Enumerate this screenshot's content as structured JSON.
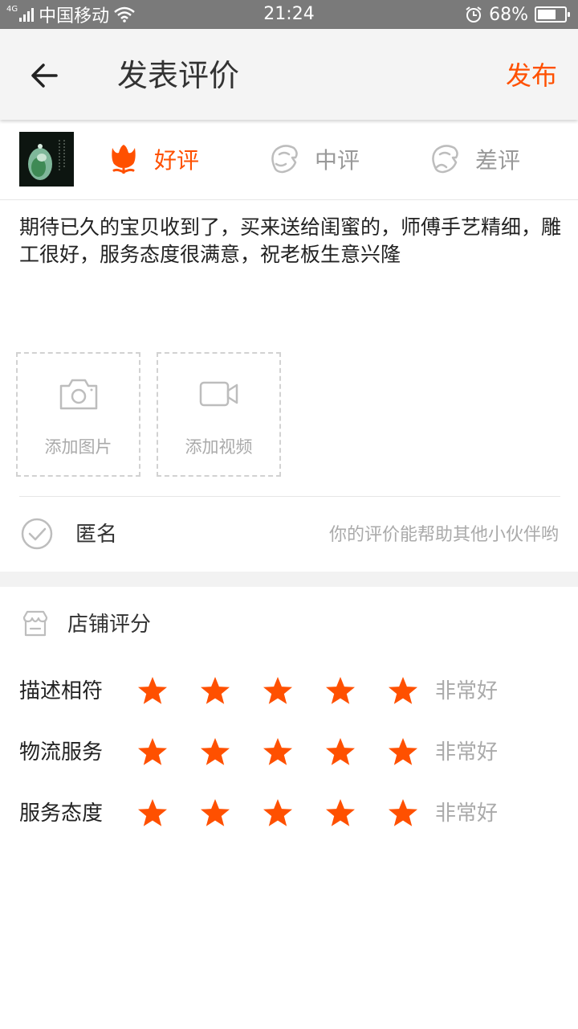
{
  "status_bar": {
    "network": "4G",
    "carrier": "中国移动",
    "time": "21:24",
    "battery": "68%",
    "battery_level": 0.68
  },
  "header": {
    "title": "发表评价",
    "publish_label": "发布"
  },
  "rating_options": {
    "good": "好评",
    "medium": "中评",
    "bad": "差评",
    "selected": "good"
  },
  "review": {
    "text": "期待已久的宝贝收到了，买来送给闺蜜的，师傅手艺精细，雕工很好，服务态度很满意，祝老板生意兴隆"
  },
  "media": {
    "add_photo": "添加图片",
    "add_video": "添加视频"
  },
  "anonymous": {
    "label": "匿名",
    "hint": "你的评价能帮助其他小伙伴哟",
    "checked": false
  },
  "shop_score": {
    "title": "店铺评分",
    "rows": [
      {
        "name": "描述相符",
        "stars": 5,
        "max": 5,
        "verdict": "非常好"
      },
      {
        "name": "物流服务",
        "stars": 5,
        "max": 5,
        "verdict": "非常好"
      },
      {
        "name": "服务态度",
        "stars": 5,
        "max": 5,
        "verdict": "非常好"
      }
    ]
  },
  "colors": {
    "accent": "#ff5000",
    "muted": "#999999",
    "status_bar": "#7a7a7a",
    "header_bg": "#f4f4f4"
  },
  "icons": {
    "back": "arrow-left-icon",
    "good": "flower-icon",
    "medium": "neutral-face-icon",
    "bad": "sad-face-icon",
    "photo": "camera-icon",
    "video": "video-camera-icon",
    "anonymous": "check-circle-icon",
    "shop": "shop-icon",
    "star": "star-icon"
  }
}
